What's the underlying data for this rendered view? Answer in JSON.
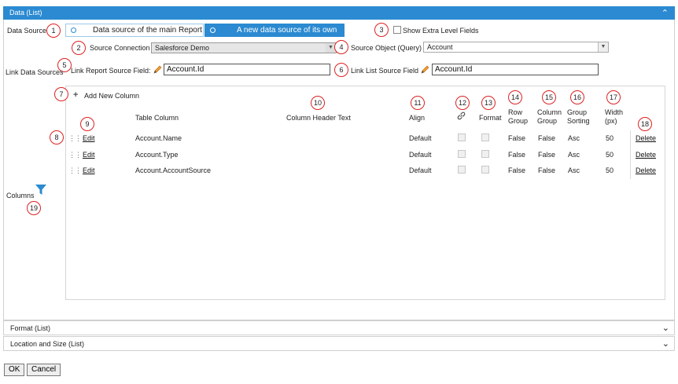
{
  "panel": {
    "title": "Data (List)"
  },
  "badges": [
    "1",
    "2",
    "3",
    "4",
    "5",
    "6",
    "7",
    "8",
    "9",
    "10",
    "11",
    "12",
    "13",
    "14",
    "15",
    "16",
    "17",
    "18",
    "19"
  ],
  "data_source": {
    "label": "Data Source",
    "option_main": "Data source of the main Report",
    "option_own": "A new data source of its own",
    "show_extra_label": "Show Extra Level Fields"
  },
  "connection": {
    "label": "Source Connection",
    "value": "Salesforce Demo",
    "source_object_label": "Source Object (Query)",
    "source_object_value": "Account"
  },
  "link": {
    "label": "Link Data Sources",
    "report_field_label": "Link Report Source Field:",
    "report_field_value": "Account.Id",
    "list_field_label": "Link List Source Field",
    "list_field_value": "Account.Id"
  },
  "grid": {
    "add_label": "Add New Column",
    "headers": {
      "table_column": "Table Column",
      "header_text": "Column Header Text",
      "align": "Align",
      "format": "Format",
      "row_group_1": "Row",
      "row_group_2": "Group",
      "col_group_1": "Column",
      "col_group_2": "Group",
      "group_sort_1": "Group",
      "group_sort_2": "Sorting",
      "width_1": "Width",
      "width_2": "(px)"
    },
    "rows": [
      {
        "edit": "Edit",
        "column": "Account.Name",
        "header": "",
        "align": "Default",
        "row_group": "False",
        "col_group": "False",
        "sorting": "Asc",
        "width": "50",
        "delete": "Delete"
      },
      {
        "edit": "Edit",
        "column": "Account.Type",
        "header": "",
        "align": "Default",
        "row_group": "False",
        "col_group": "False",
        "sorting": "Asc",
        "width": "50",
        "delete": "Delete"
      },
      {
        "edit": "Edit",
        "column": "Account.AccountSource",
        "header": "",
        "align": "Default",
        "row_group": "False",
        "col_group": "False",
        "sorting": "Asc",
        "width": "50",
        "delete": "Delete"
      }
    ]
  },
  "columns_label": "Columns",
  "sections": {
    "format": "Format (List)",
    "location": "Location and Size (List)"
  },
  "buttons": {
    "ok": "OK",
    "cancel": "Cancel"
  },
  "colors": {
    "accent": "#2b8ad1",
    "badge": "#dd2222"
  },
  "icons": [
    "chevron-up-icon",
    "chevron-down-icon",
    "radio-icon",
    "pencil-icon",
    "plus-icon",
    "link-icon",
    "drag-handle-icon",
    "filter-icon",
    "dropdown-arrow-icon"
  ]
}
